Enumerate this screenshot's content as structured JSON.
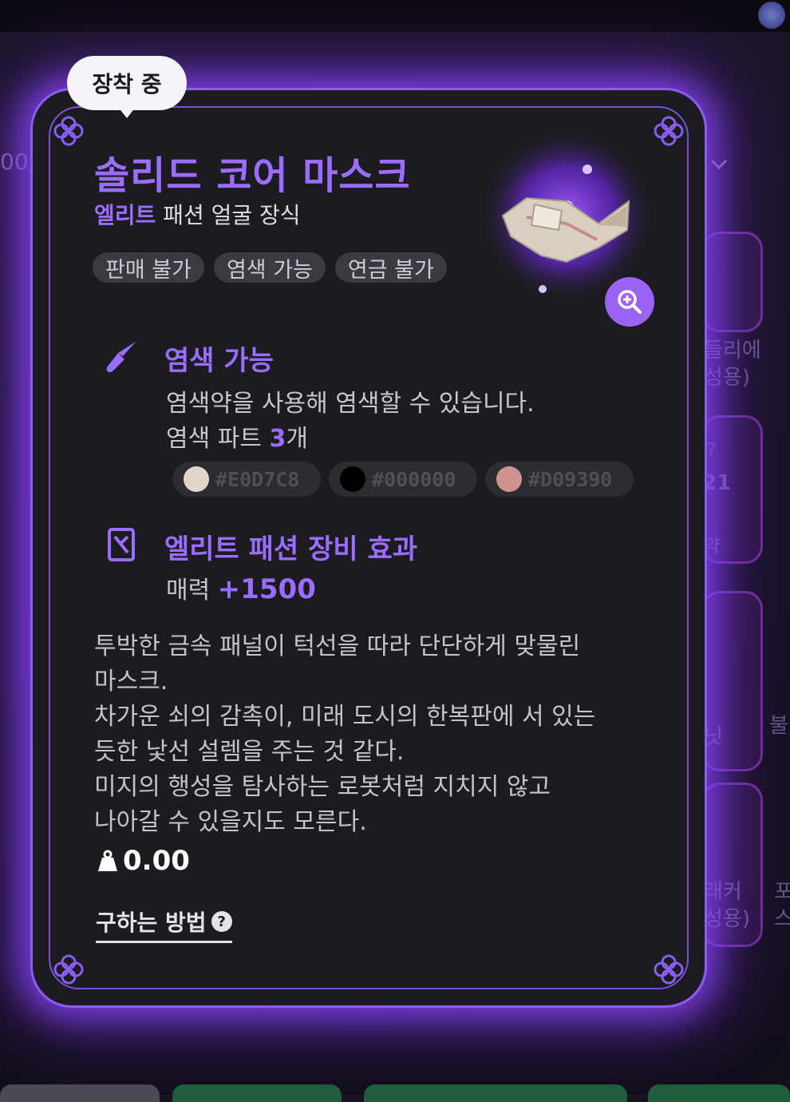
{
  "badge": {
    "label": "장착 중"
  },
  "item": {
    "name": "솔리드 코어 마스크",
    "grade": "엘리트",
    "category": "패션 얼굴 장식",
    "tags": [
      "판매 불가",
      "염색 가능",
      "연금 불가"
    ]
  },
  "dye": {
    "title": "염색 가능",
    "line1": "염색약을 사용해 염색할 수 있습니다.",
    "parts_prefix": "염색 파트 ",
    "parts_count": "3",
    "parts_suffix": "개",
    "colors": [
      {
        "hex": "#E0D7C8",
        "label": "#E0D7C8"
      },
      {
        "hex": "#000000",
        "label": "#000000"
      },
      {
        "hex": "#D09390",
        "label": "#D09390"
      }
    ]
  },
  "effect": {
    "title": "엘리트 패션 장비 효과",
    "stat_name": "매력 ",
    "stat_value": "+1500"
  },
  "description": [
    "투박한 금속 패널이 턱선을 따라 단단하게 맞물린",
    "마스크.",
    "차가운 쇠의 감촉이, 미래 도시의 한복판에 서 있는",
    "듯한 낯선 설렘을 주는 것 같다.",
    "미지의 행성을 탐사하는 로봇처럼 지치지 않고",
    "나아갈 수 있을지도 모른다."
  ],
  "weight": "0.00",
  "how_to_get": "구하는 방법",
  "background": {
    "left_number": "00",
    "right_texts": [
      "들리에",
      "성용)",
      "?",
      "21",
      "래커",
      "성용)",
      "불",
      "포",
      "스",
      "닛",
      "약"
    ]
  },
  "colors": {
    "accent": "#9b6dff",
    "card_bg": "#1c1c20",
    "glow": "#8a4fff"
  }
}
